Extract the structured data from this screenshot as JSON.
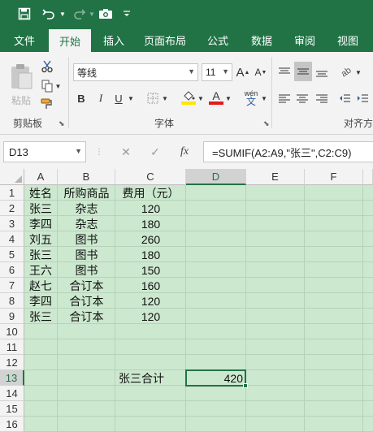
{
  "colors": {
    "brand": "#217346",
    "sheet_bg": "#cce8cf",
    "font_color_bar": "#e21b1b",
    "highlight_bar": "#ffe600"
  },
  "qat": {
    "save_icon": "save-icon",
    "undo_icon": "undo-icon",
    "redo_icon": "redo-icon",
    "camera_icon": "camera-icon",
    "customize_icon": "customize-qat-icon"
  },
  "tabs": [
    "文件",
    "开始",
    "插入",
    "页面布局",
    "公式",
    "数据",
    "审阅",
    "视图"
  ],
  "ribbon": {
    "clipboard": {
      "paste_label": "粘贴",
      "group_label": "剪贴板"
    },
    "font": {
      "font_name": "等线",
      "font_size": "11",
      "grow_label": "A",
      "shrink_label": "A",
      "bold": "B",
      "italic": "I",
      "underline": "U",
      "phonetic": "wén",
      "group_label": "字体"
    },
    "alignment": {
      "group_label": "对齐方"
    }
  },
  "formula_bar": {
    "name_box": "D13",
    "cancel": "✕",
    "enter": "✓",
    "fx": "fx",
    "formula": "=SUMIF(A2:A9,\"张三\",C2:C9)"
  },
  "sheet": {
    "columns": [
      "A",
      "B",
      "C",
      "D",
      "E",
      "F"
    ],
    "rows": [
      "1",
      "2",
      "3",
      "4",
      "5",
      "6",
      "7",
      "8",
      "9",
      "10",
      "11",
      "12",
      "13",
      "14",
      "15",
      "16"
    ],
    "header": {
      "a": "姓名",
      "b": "所购商品",
      "c": "费用（元）"
    },
    "data": [
      {
        "a": "张三",
        "b": "杂志",
        "c": "120"
      },
      {
        "a": "李四",
        "b": "杂志",
        "c": "180"
      },
      {
        "a": "刘五",
        "b": "图书",
        "c": "260"
      },
      {
        "a": "张三",
        "b": "图书",
        "c": "180"
      },
      {
        "a": "王六",
        "b": "图书",
        "c": "150"
      },
      {
        "a": "赵七",
        "b": "合订本",
        "c": "160"
      },
      {
        "a": "李四",
        "b": "合订本",
        "c": "120"
      },
      {
        "a": "张三",
        "b": "合订本",
        "c": "120"
      }
    ],
    "summary": {
      "label": "张三合计",
      "value": "420"
    },
    "selected_cell": "D13"
  }
}
